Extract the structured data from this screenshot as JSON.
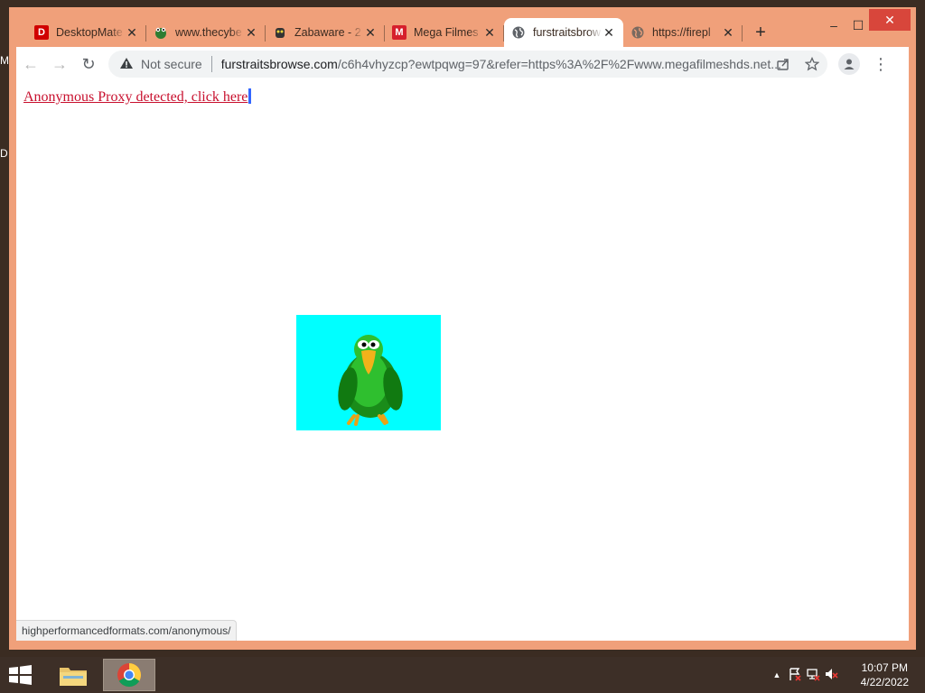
{
  "desktop": {
    "edge_glyphs": [
      "M",
      "D"
    ]
  },
  "window": {
    "caption": {
      "minimize": "–",
      "maximize": "☐",
      "close": "✕"
    },
    "tabs": [
      {
        "title": "DesktopMate",
        "favicon": "D",
        "favicon_bg": "#d00000",
        "favicon_color": "#ffffff",
        "close": "✕",
        "active": false
      },
      {
        "title": "www.thecybe",
        "favicon": "🐸",
        "favicon_bg": "transparent",
        "favicon_color": "#2e7d32",
        "close": "✕",
        "active": false
      },
      {
        "title": "Zabaware - 2",
        "favicon": "◆",
        "favicon_bg": "transparent",
        "favicon_color": "#333333",
        "close": "✕",
        "active": false
      },
      {
        "title": "Mega Filmes",
        "favicon": "M",
        "favicon_bg": "#d61f2c",
        "favicon_color": "#ffffff",
        "close": "✕",
        "active": false
      },
      {
        "title": "furstraitsbrow",
        "favicon": "globe",
        "close": "✕",
        "active": true
      },
      {
        "title": "https://firepl",
        "favicon": "globe",
        "close": "✕",
        "active": false
      }
    ],
    "new_tab": "+"
  },
  "toolbar": {
    "back": "←",
    "forward": "→",
    "reload": "↻",
    "security_icon": "warning-triangle-icon",
    "security_label": "Not secure",
    "url_host": "furstraitsbrowse.com",
    "url_rest": "/c6h4vhyzcp?ewtpqwg=97&refer=https%3A%2F%2Fwww.megafilmeshds.net...",
    "share_icon": "share-icon",
    "star_icon": "star-icon",
    "profile_icon": "person-icon",
    "menu_icon": "⋮"
  },
  "page": {
    "link_text": "Anonymous Proxy detected, click here",
    "image_bg": "#00ffff",
    "status_url": "highperformancedformats.com/anonymous/"
  },
  "taskbar": {
    "clock_time": "10:07 PM",
    "clock_date": "4/22/2022",
    "tray_arrow": "▲"
  },
  "colors": {
    "window_frame": "#f0a07a",
    "link": "#c8102e",
    "taskbar": "#3d2f27"
  }
}
